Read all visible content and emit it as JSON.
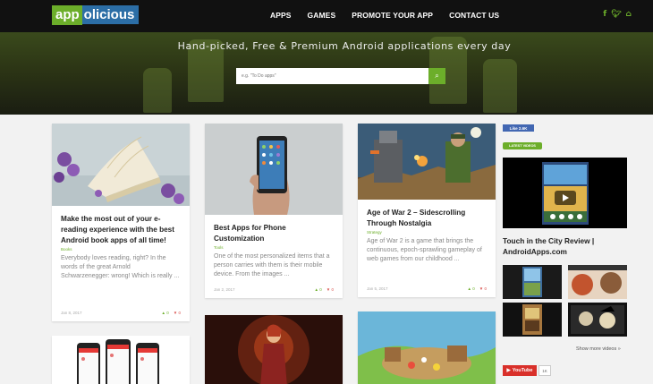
{
  "header": {
    "logo_part1": "app",
    "logo_part2": "olicious",
    "nav": [
      "APPS",
      "GAMES",
      "PROMOTE YOUR APP",
      "CONTACT US"
    ],
    "social_icons": [
      "facebook-icon",
      "twitter-icon",
      "android-icon"
    ],
    "accent_color": "#6cae2a"
  },
  "hero": {
    "tagline": "Hand-picked, Free & Premium Android applications every day",
    "search_placeholder": "e.g. \"To Do apps\""
  },
  "cards": [
    {
      "title": "Make the most out of your e-reading experience with the best Android book apps of all time!",
      "category": "Books",
      "excerpt": "Everybody loves reading, right? In the words of the great Arnold Schwarzenegger: wrong! Which is really ...",
      "date": "Jan 8, 2017",
      "likes": "0",
      "dislikes": "0"
    },
    {
      "title": "Best Apps for Phone Customization",
      "category": "Tools",
      "excerpt": "One of the most personalized items that a person carries with them is their mobile device. From the images ...",
      "date": "Jan 2, 2017",
      "likes": "0",
      "dislikes": "0"
    },
    {
      "title": "Age of War 2 – Sidescrolling Through Nostalgia",
      "category": "Strategy",
      "excerpt": "Age of War 2 is a game that brings the continuous, epoch-sprawling gameplay of web games from our childhood ...",
      "date": "Jan 5, 2017",
      "likes": "0",
      "dislikes": "0"
    }
  ],
  "sidebar": {
    "fb_like": "Like 2.6K",
    "latest_label": "LATEST VIDEOS",
    "video_title": "Touch in the City Review | AndroidApps.com",
    "more_videos": "Show more videos »",
    "youtube_label": "YouTube",
    "youtube_count": "1K"
  }
}
